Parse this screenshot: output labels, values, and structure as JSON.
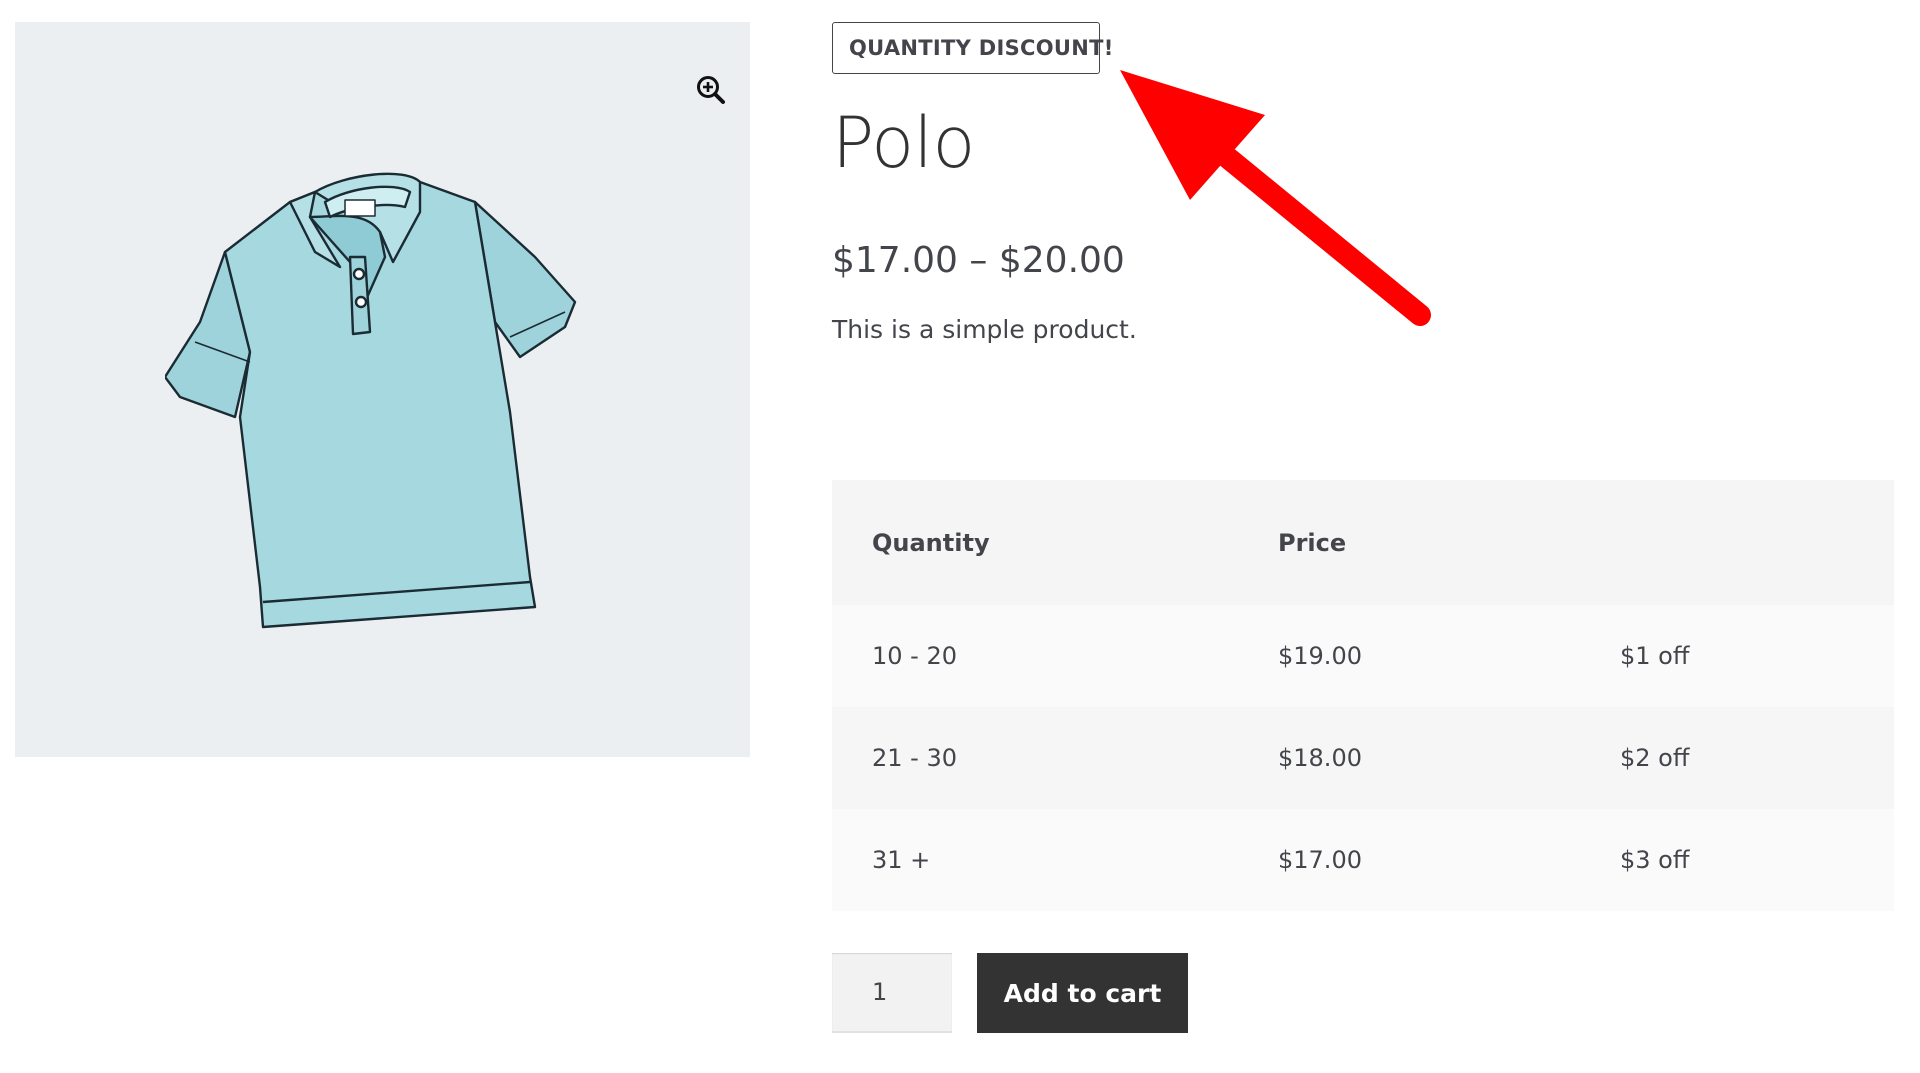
{
  "badge": "QUANTITY DISCOUNT!",
  "product": {
    "title": "Polo",
    "price_range": "$17.00 – $20.00",
    "description": "This is a simple product."
  },
  "pricing_table": {
    "headers": [
      "Quantity",
      "Price",
      ""
    ],
    "rows": [
      {
        "quantity": "10 - 20",
        "price": "$19.00",
        "discount": "$1 off"
      },
      {
        "quantity": "21 - 30",
        "price": "$18.00",
        "discount": "$2 off"
      },
      {
        "quantity": "31 +",
        "price": "$17.00",
        "discount": "$3 off"
      }
    ]
  },
  "cart": {
    "quantity_value": "1",
    "add_button_label": "Add to cart"
  },
  "icons": {
    "zoom": "zoom-in-icon",
    "arrow": "red-arrow-annotation"
  },
  "colors": {
    "button_bg": "#333333",
    "text": "#43454b",
    "gallery_bg": "#ebeff2",
    "arrow": "#ff0000",
    "shirt": "#a6d8e0"
  }
}
